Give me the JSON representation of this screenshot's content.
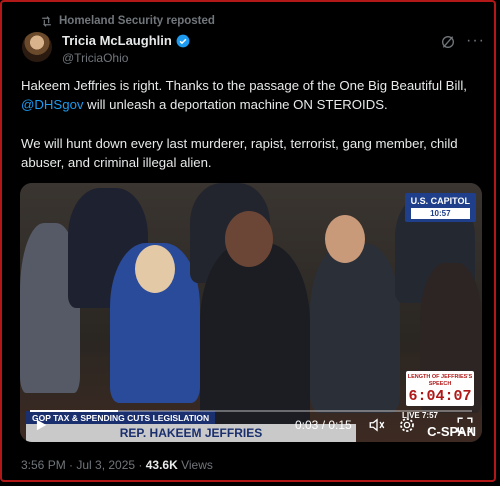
{
  "repost": {
    "text": "Homeland Security reposted"
  },
  "author": {
    "name": "Tricia McLaughlin",
    "handle": "@TriciaOhio"
  },
  "post": {
    "line1_a": "Hakeem Jeffries is right. Thanks to the  passage of the One Big Beautiful Bill, ",
    "mention": "@DHSgov",
    "line1_b": " will unleash a deportation machine ON STEROIDS.",
    "paragraph2": "We will hunt down every last murderer, rapist, terrorist, gang member, child abuser, and criminal illegal alien."
  },
  "video": {
    "capitol_label": "U.S. CAPITOL",
    "capitol_time": "10:57",
    "speech_label": "LENGTH OF JEFFRIES'S SPEECH",
    "speech_time": "6:04:07",
    "legislation": "GOP TAX & SPENDING CUTS LEGISLATION",
    "speaker": "REP. HAKEEM JEFFRIES",
    "live": "LIVE",
    "live_time": "7:57",
    "network": "C-SPAN",
    "timer": "0:03 / 0:15",
    "progress": 0.2
  },
  "meta": {
    "timestamp": "3:56 PM · Jul 3, 2025 · ",
    "views": "43.6K",
    "views_label": " Views"
  },
  "colors": {
    "accent": "#1d9bf0",
    "border": "#b31818",
    "muted": "#71767b"
  },
  "icons": [
    "repost-icon",
    "verified-icon",
    "grok-icon",
    "more-icon",
    "play-icon",
    "volume-icon",
    "settings-icon",
    "fullscreen-icon"
  ]
}
